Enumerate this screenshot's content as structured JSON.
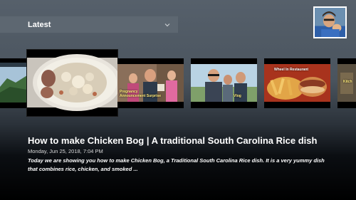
{
  "header": {
    "category_label": "Latest",
    "chevron_icon": "chevron-down-icon"
  },
  "profile": {
    "avatar_icon": "user-avatar"
  },
  "thumbnails": [
    {
      "name": "thumbnail-mountain",
      "text": ""
    },
    {
      "name": "thumbnail-chicken-bog",
      "text": ""
    },
    {
      "name": "thumbnail-family",
      "text": "Pregnancy Announcement Surprise"
    },
    {
      "name": "thumbnail-friends",
      "text": "Vlog"
    },
    {
      "name": "thumbnail-restaurant",
      "text": "Wheel In Restaurant"
    },
    {
      "name": "thumbnail-partial",
      "text": "Kitch"
    }
  ],
  "selected_video": {
    "title": "How to make Chicken Bog | A traditional South Carolina Rice dish",
    "date": "Monday, Jun 25, 2018, 7:04 PM",
    "description": "Today we are showing you how to make Chicken Bog, a Traditional South Carolina Rice dish. It is a very yummy dish that combines rice, chicken, and smoked ..."
  }
}
